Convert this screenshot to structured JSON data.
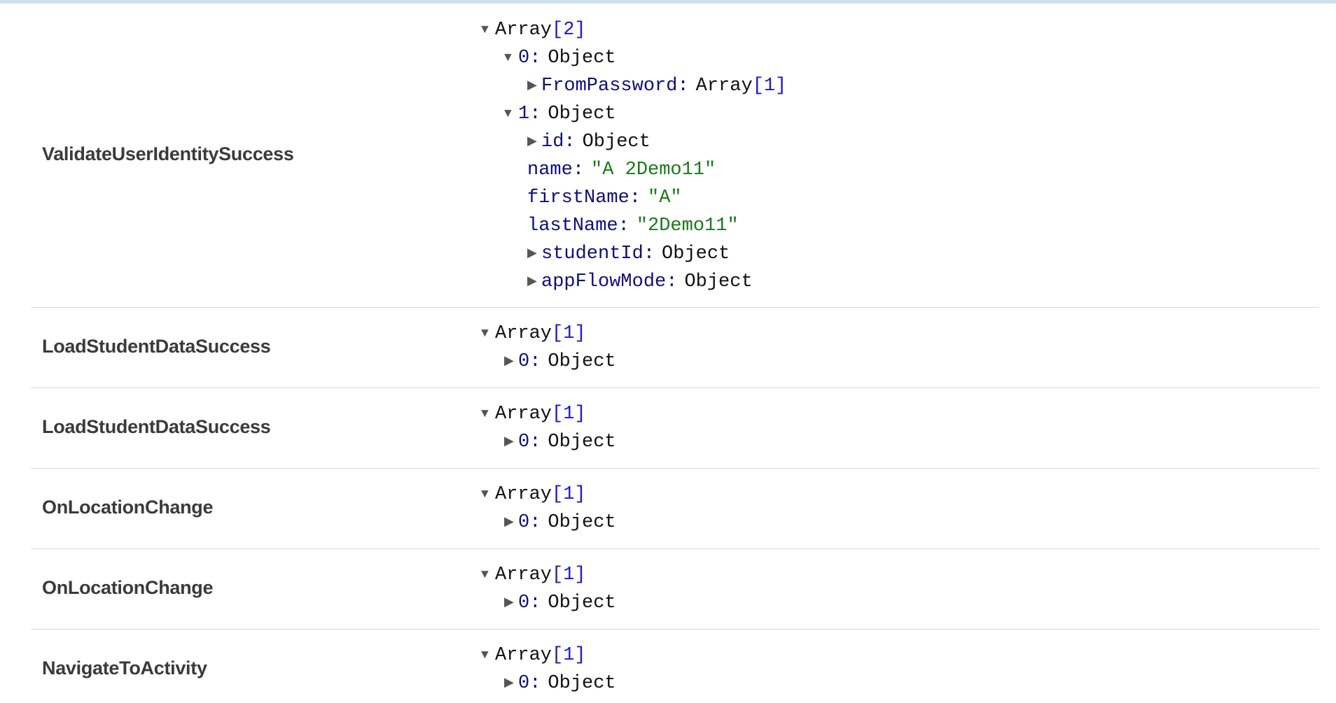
{
  "rows": [
    {
      "action": "ValidateUserIdentitySuccess",
      "root": {
        "label": "Array",
        "count": "[2]"
      },
      "children": [
        {
          "key": "0",
          "value": "Object",
          "expanded": true,
          "children": [
            {
              "key": "FromPassword",
              "value": "Array",
              "count": "[1]"
            }
          ]
        },
        {
          "key": "1",
          "value": "Object",
          "expanded": true,
          "children": [
            {
              "key": "id",
              "value": "Object"
            },
            {
              "key": "name",
              "string": "\"A 2Demo11\""
            },
            {
              "key": "firstName",
              "string": "\"A\""
            },
            {
              "key": "lastName",
              "string": "\"2Demo11\""
            },
            {
              "key": "studentId",
              "value": "Object"
            },
            {
              "key": "appFlowMode",
              "value": "Object"
            }
          ]
        }
      ]
    },
    {
      "action": "LoadStudentDataSuccess",
      "root": {
        "label": "Array",
        "count": "[1]"
      },
      "children": [
        {
          "key": "0",
          "value": "Object"
        }
      ]
    },
    {
      "action": "LoadStudentDataSuccess",
      "root": {
        "label": "Array",
        "count": "[1]"
      },
      "children": [
        {
          "key": "0",
          "value": "Object"
        }
      ]
    },
    {
      "action": "OnLocationChange",
      "root": {
        "label": "Array",
        "count": "[1]"
      },
      "children": [
        {
          "key": "0",
          "value": "Object"
        }
      ]
    },
    {
      "action": "OnLocationChange",
      "root": {
        "label": "Array",
        "count": "[1]"
      },
      "children": [
        {
          "key": "0",
          "value": "Object"
        }
      ]
    },
    {
      "action": "NavigateToActivity",
      "root": {
        "label": "Array",
        "count": "[1]"
      },
      "children": [
        {
          "key": "0",
          "value": "Object"
        }
      ]
    }
  ],
  "icons": {
    "expanded": "triangle-down-icon",
    "collapsed": "triangle-right-icon"
  },
  "colors": {
    "key": "#0f0f7a",
    "string": "#1a7a1a",
    "bracket": "#1a1acc",
    "action": "#3a3a3a"
  }
}
